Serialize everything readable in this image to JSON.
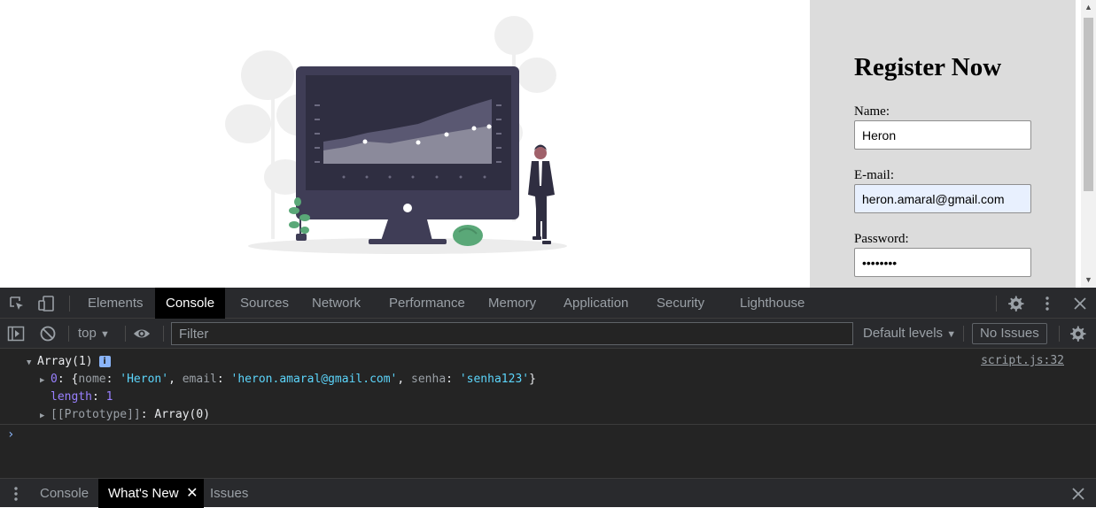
{
  "register": {
    "title": "Register Now",
    "name_label": "Name:",
    "name_value": "Heron",
    "email_label": "E-mail:",
    "email_value": "heron.amaral@gmail.com",
    "password_label": "Password:",
    "password_value": "senha123"
  },
  "devtools": {
    "tabs": [
      "Elements",
      "Console",
      "Sources",
      "Network",
      "Performance",
      "Memory",
      "Application",
      "Security",
      "Lighthouse"
    ],
    "active_tab": "Console",
    "toolbar": {
      "context": "top",
      "filter_placeholder": "Filter",
      "levels": "Default levels",
      "issues": "No Issues"
    },
    "console": {
      "header": "Array(1)",
      "info_badge": "i",
      "source": "script.js:32",
      "item_index": "0",
      "item_nome_key": "nome",
      "item_nome_val": "'Heron'",
      "item_email_key": "email",
      "item_email_val": "'heron.amaral@gmail.com'",
      "item_senha_key": "senha",
      "item_senha_val": "'senha123'",
      "length_key": "length",
      "length_val": "1",
      "proto_key": "[[Prototype]]",
      "proto_val": "Array(0)",
      "prompt": "›"
    },
    "drawer": {
      "tabs": [
        "Console",
        "What's New",
        "Issues"
      ],
      "active": "What's New"
    }
  },
  "icons": {
    "inspect": "inspect-element-icon",
    "device": "device-toolbar-icon",
    "settings": "gear-icon",
    "more": "kebab-menu-icon",
    "close": "close-icon",
    "sidebar": "show-sidebar-icon",
    "clear": "clear-console-icon",
    "eye": "eye-icon"
  },
  "colors": {
    "panel_bg": "#dcdcdc",
    "devtools_bg": "#242424",
    "string_color": "#5cd5fb",
    "key_color": "#9980ff",
    "autofill_bg": "#e8f0fe"
  }
}
